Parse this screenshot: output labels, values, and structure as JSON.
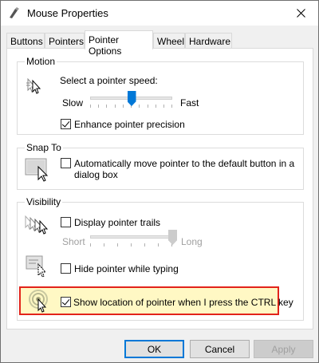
{
  "window": {
    "title": "Mouse Properties",
    "icon": "mouse-pointer-icon"
  },
  "tabs": [
    {
      "label": "Buttons",
      "active": false
    },
    {
      "label": "Pointers",
      "active": false
    },
    {
      "label": "Pointer Options",
      "active": true
    },
    {
      "label": "Wheel",
      "active": false
    },
    {
      "label": "Hardware",
      "active": false
    }
  ],
  "motion": {
    "group_title": "Motion",
    "speed_label": "Select a pointer speed:",
    "slow_label": "Slow",
    "fast_label": "Fast",
    "speed_value_fraction": 0.5,
    "precision_label": "Enhance pointer precision",
    "precision_checked": true
  },
  "snap_to": {
    "group_title": "Snap To",
    "snap_label_line1": "Automatically move pointer to the default button in a",
    "snap_label_line2": "dialog box",
    "snap_checked": false
  },
  "visibility": {
    "group_title": "Visibility",
    "trails_label": "Display pointer trails",
    "trails_checked": false,
    "short_label": "Short",
    "long_label": "Long",
    "trail_length_fraction": 1.0,
    "hide_label": "Hide pointer while typing",
    "hide_checked": false,
    "show_location_label": "Show location of pointer when I press the CTRL key",
    "show_location_checked": true
  },
  "buttons": {
    "ok": "OK",
    "cancel": "Cancel",
    "apply": "Apply"
  },
  "colors": {
    "accent": "#0078d7",
    "highlight_border": "#e2231a",
    "highlight_fill": "#fff8c4"
  }
}
